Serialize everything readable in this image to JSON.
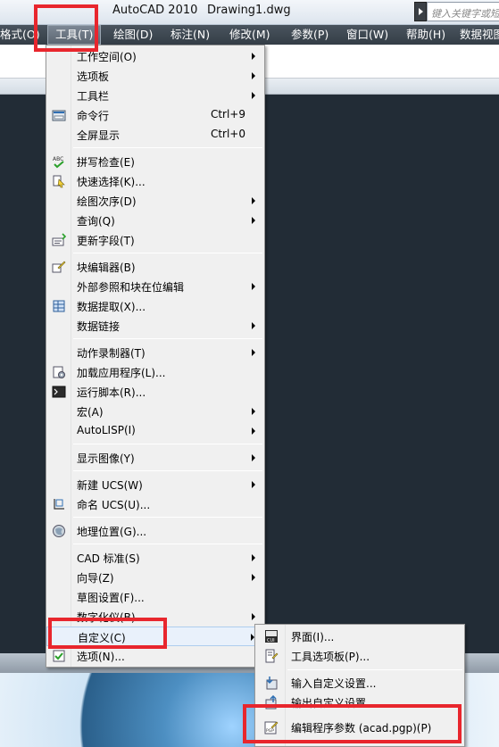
{
  "titlebar": {
    "app_title": "AutoCAD 2010",
    "doc_title": "Drawing1.dwg",
    "search_placeholder": "键入关键字或短"
  },
  "menubar": {
    "items": [
      {
        "label": "格式(O)"
      },
      {
        "label": "工具(T)"
      },
      {
        "label": "绘图(D)"
      },
      {
        "label": "标注(N)"
      },
      {
        "label": "修改(M)"
      },
      {
        "label": "参数(P)"
      },
      {
        "label": "窗口(W)"
      },
      {
        "label": "帮助(H)"
      },
      {
        "label": "数据视图"
      }
    ]
  },
  "tools_menu": {
    "items": [
      {
        "label": "工作空间(O)",
        "arrow": true
      },
      {
        "label": "选项板",
        "arrow": true
      },
      {
        "label": "工具栏",
        "arrow": true
      },
      {
        "label": "命令行",
        "shortcut": "Ctrl+9",
        "icon": "command-line-icon"
      },
      {
        "label": "全屏显示",
        "shortcut": "Ctrl+0"
      },
      {
        "label": "拼写检查(E)",
        "icon": "spell-check-icon"
      },
      {
        "label": "快速选择(K)...",
        "icon": "quick-select-icon"
      },
      {
        "label": "绘图次序(D)",
        "arrow": true
      },
      {
        "label": "查询(Q)",
        "arrow": true
      },
      {
        "label": "更新字段(T)",
        "icon": "update-field-icon"
      },
      {
        "label": "块编辑器(B)",
        "icon": "block-editor-icon"
      },
      {
        "label": "外部参照和块在位编辑",
        "arrow": true
      },
      {
        "label": "数据提取(X)...",
        "icon": "data-extraction-icon"
      },
      {
        "label": "数据链接",
        "arrow": true
      },
      {
        "label": "动作录制器(T)",
        "arrow": true
      },
      {
        "label": "加载应用程序(L)...",
        "icon": "load-application-icon"
      },
      {
        "label": "运行脚本(R)...",
        "icon": "run-script-icon"
      },
      {
        "label": "宏(A)",
        "arrow": true
      },
      {
        "label": "AutoLISP(I)",
        "arrow": true
      },
      {
        "label": "显示图像(Y)",
        "arrow": true
      },
      {
        "label": "新建 UCS(W)",
        "arrow": true
      },
      {
        "label": "命名 UCS(U)...",
        "icon": "named-ucs-icon"
      },
      {
        "label": "地理位置(G)...",
        "icon": "geographic-location-icon"
      },
      {
        "label": "CAD 标准(S)",
        "arrow": true
      },
      {
        "label": "向导(Z)",
        "arrow": true
      },
      {
        "label": "草图设置(F)..."
      },
      {
        "label": "数字化仪(B)",
        "arrow": true
      },
      {
        "label": "自定义(C)",
        "arrow": true
      },
      {
        "label": "选项(N)...",
        "icon": "options-check-icon"
      }
    ]
  },
  "customize_submenu": {
    "items": [
      {
        "label": "界面(I)...",
        "icon": "cui-icon"
      },
      {
        "label": "工具选项板(P)...",
        "icon": "tool-palettes-icon"
      },
      {
        "label": "输入自定义设置...",
        "icon": "import-customizations-icon"
      },
      {
        "label": "输出自定义设置",
        "icon": "export-customizations-icon"
      },
      {
        "label": "编辑程序参数 (acad.pgp)(P)",
        "icon": "edit-pgp-icon"
      }
    ]
  },
  "colors": {
    "highlight_box": "#e8262d",
    "menubar_bg": "#3d464f",
    "drawing_bg": "#222c36"
  }
}
